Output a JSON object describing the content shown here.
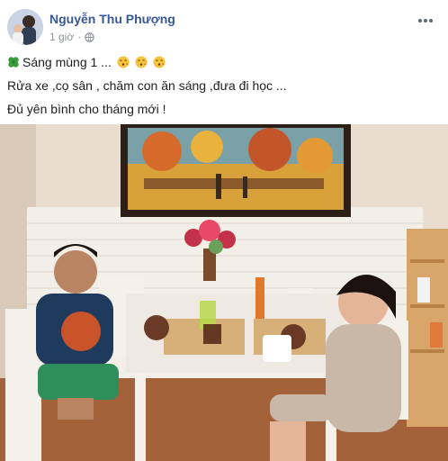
{
  "post": {
    "author": "Nguyễn Thu Phượng",
    "time": "1 giờ",
    "privacy_icon": "globe-icon",
    "more_icon": "more-options-icon",
    "lines": [
      "Sáng mùng 1 ...",
      "Rửa xe ,cọ sân , chăm con ăn sáng ,đưa đi học ...",
      "Đủ yên bình cho tháng mới !"
    ],
    "line1_leading_icon": "four-leaf-clover-icon",
    "line1_trailing_icons": [
      "kissing-face-icon",
      "kissing-face-icon",
      "kissing-face-icon"
    ],
    "photo_description_icons": [
      "painting",
      "flower-vase",
      "table",
      "boy",
      "girl",
      "shelf"
    ]
  },
  "colors": {
    "author": "#365899",
    "meta": "#90949c",
    "text": "#1c1e21"
  }
}
